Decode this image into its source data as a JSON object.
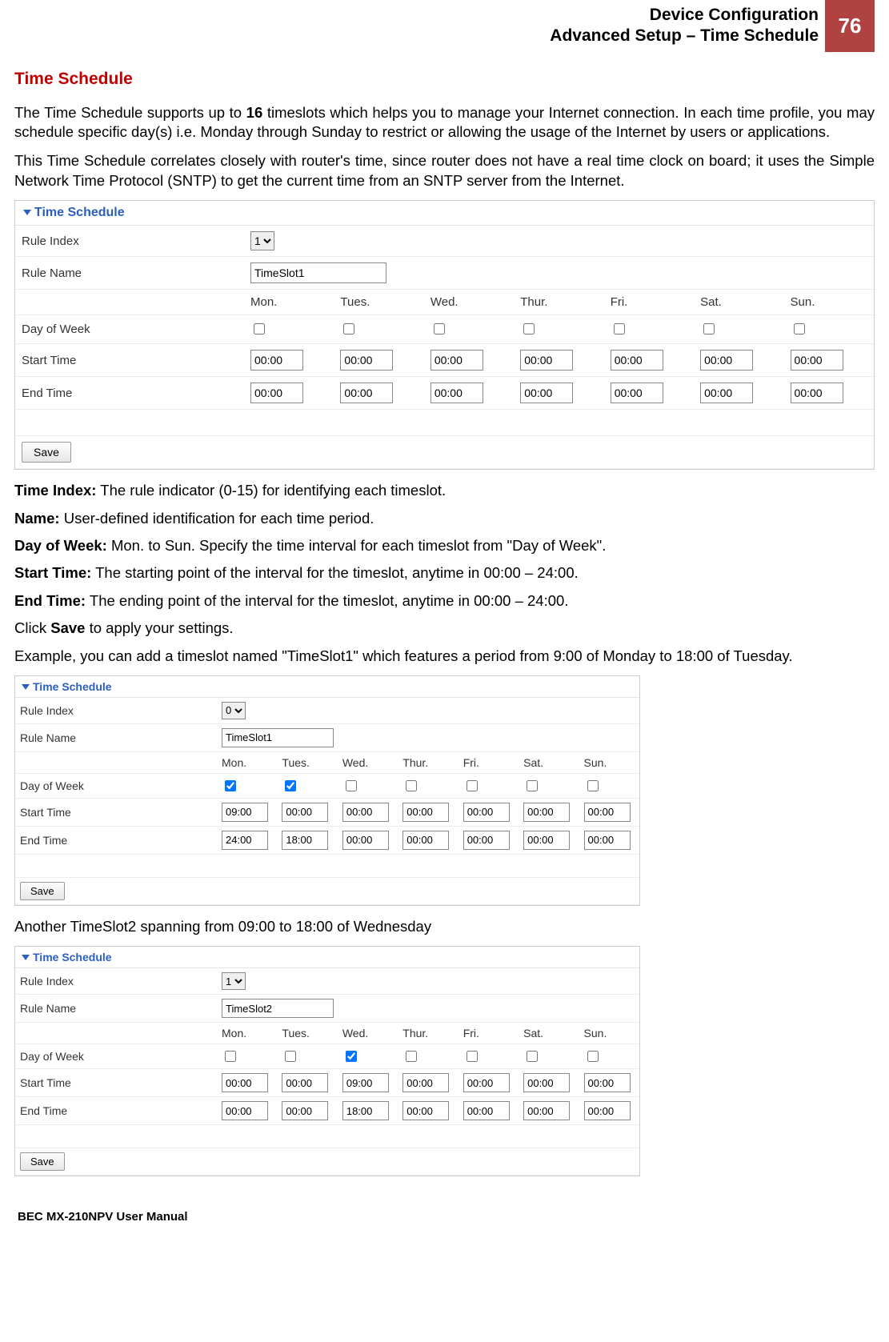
{
  "header": {
    "line1": "Device Configuration",
    "line2": "Advanced Setup – Time Schedule",
    "page_number": "76"
  },
  "section_title": "Time Schedule",
  "intro_p1a": "The Time Schedule supports up to ",
  "intro_p1_bold": "16",
  "intro_p1b": " timeslots which helps you to manage your Internet connection. In each time profile, you may schedule specific day(s) i.e. Monday through Sunday to restrict or allowing the usage of the Internet by users or applications.",
  "intro_p2": "This Time Schedule correlates closely with router's time, since router does not have a real time clock on board; it uses the Simple Network Time Protocol (SNTP) to get the current time from an SNTP server from the Internet.",
  "days": [
    "Mon.",
    "Tues.",
    "Wed.",
    "Thur.",
    "Fri.",
    "Sat.",
    "Sun."
  ],
  "labels": {
    "panel_title": "Time Schedule",
    "rule_index": "Rule Index",
    "rule_name": "Rule Name",
    "day_of_week": "Day of Week",
    "start_time": "Start Time",
    "end_time": "End Time",
    "save": "Save"
  },
  "panel1": {
    "rule_index": "1",
    "rule_name": "TimeSlot1",
    "checked": [
      false,
      false,
      false,
      false,
      false,
      false,
      false
    ],
    "start": [
      "00:00",
      "00:00",
      "00:00",
      "00:00",
      "00:00",
      "00:00",
      "00:00"
    ],
    "end": [
      "00:00",
      "00:00",
      "00:00",
      "00:00",
      "00:00",
      "00:00",
      "00:00"
    ]
  },
  "defs": {
    "time_index_label": "Time Index:",
    "time_index_text": " The rule indicator (0-15) for identifying each timeslot.",
    "name_label": "Name:",
    "name_text": " User-defined identification for each time period.",
    "dow_label": "Day of Week:",
    "dow_text": " Mon. to Sun. Specify the time interval for each timeslot from \"Day of Week\".",
    "start_label": "Start Time:",
    "start_text": " The starting point of the interval for the timeslot, anytime in 00:00 – 24:00.",
    "end_label": "End Time:",
    "end_text": " The ending point of the interval for the timeslot, anytime in 00:00 – 24:00.",
    "click_a": "Click ",
    "click_bold": "Save",
    "click_b": " to apply your settings."
  },
  "example1_text": "Example, you can add a timeslot named \"TimeSlot1\" which features a period from 9:00 of Monday to 18:00 of Tuesday.",
  "panel2": {
    "rule_index": "0",
    "rule_name": "TimeSlot1",
    "checked": [
      true,
      true,
      false,
      false,
      false,
      false,
      false
    ],
    "start": [
      "09:00",
      "00:00",
      "00:00",
      "00:00",
      "00:00",
      "00:00",
      "00:00"
    ],
    "end": [
      "24:00",
      "18:00",
      "00:00",
      "00:00",
      "00:00",
      "00:00",
      "00:00"
    ]
  },
  "example2_text": "Another TimeSlot2 spanning from 09:00 to 18:00 of Wednesday",
  "panel3": {
    "rule_index": "1",
    "rule_name": "TimeSlot2",
    "checked": [
      false,
      false,
      true,
      false,
      false,
      false,
      false
    ],
    "start": [
      "00:00",
      "00:00",
      "09:00",
      "00:00",
      "00:00",
      "00:00",
      "00:00"
    ],
    "end": [
      "00:00",
      "00:00",
      "18:00",
      "00:00",
      "00:00",
      "00:00",
      "00:00"
    ]
  },
  "footer": "BEC MX-210NPV User Manual"
}
